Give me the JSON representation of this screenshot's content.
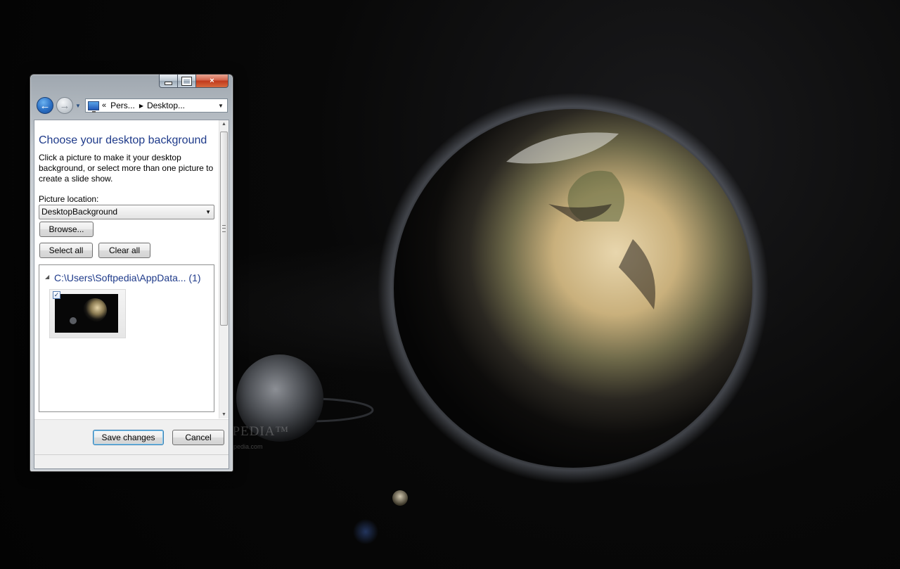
{
  "window": {
    "caption_buttons": {
      "minimize": "minimize",
      "maximize": "maximize",
      "close": "×"
    },
    "nav": {
      "back_glyph": "←",
      "forward_glyph": "→"
    },
    "address": {
      "chevron": "«",
      "crumbs": [
        "Pers...",
        "Desktop..."
      ]
    }
  },
  "page": {
    "title": "Choose your desktop background",
    "description": "Click a picture to make it your desktop background, or select more than one picture to create a slide show.",
    "location_label": "Picture location:",
    "location_value": "DesktopBackground",
    "browse_label": "Browse...",
    "select_all_label": "Select all",
    "clear_all_label": "Clear all"
  },
  "picture_list": {
    "group_header": "C:\\Users\\Softpedia\\AppData... (1)",
    "items": [
      {
        "checked": true,
        "check_glyph": "✓"
      }
    ]
  },
  "footer": {
    "save_label": "Save changes",
    "cancel_label": "Cancel"
  },
  "desktop": {
    "watermark": "SOFTPEDIA™",
    "watermark_url": "www.softpedia.com"
  },
  "icons": {
    "scroll_up": "▲",
    "scroll_down": "▼",
    "dropdown": "▼",
    "expander": "◢",
    "crumb_separator": "▶"
  }
}
